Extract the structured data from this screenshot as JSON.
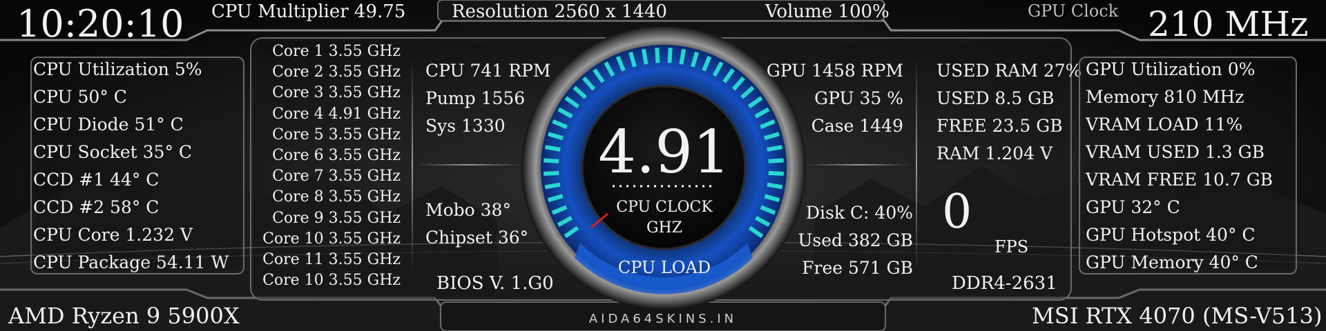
{
  "top": {
    "time": "10:20:10",
    "cpu_multiplier": "CPU Multiplier 49.75",
    "resolution": "Resolution 2560 x 1440",
    "volume": "Volume 100%",
    "gpu_clock_label": "GPU Clock",
    "gpu_clock_value": "210 MHz"
  },
  "cpu_panel": [
    "CPU Utilization 5%",
    "CPU 50° C",
    "CPU Diode 51° C",
    "CPU Socket 35° C",
    "CCD #1 44° C",
    "CCD #2 58° C",
    "CPU Core 1.232 V",
    "CPU Package 54.11 W"
  ],
  "cores": [
    "Core 1  3.55 GHz",
    "Core 2  3.55 GHz",
    "Core 3  3.55 GHz",
    "Core 4  4.91 GHz",
    "Core 5  3.55 GHz",
    "Core 6  3.55 GHz",
    "Core 7  3.55 GHz",
    "Core 8  3.55 GHz",
    "Core 9  3.55 GHz",
    "Core 10  3.55 GHz",
    "Core 11  3.55 GHz",
    "Core 10  3.55 GHz"
  ],
  "fans_left": [
    "CPU 741 RPM",
    "Pump 1556",
    "Sys 1330"
  ],
  "temps_left": [
    "Mobo 38°",
    "Chipset 36°"
  ],
  "bios": "BIOS V. 1.G0",
  "gauge": {
    "value": "4.91",
    "label_line1": "CPU CLOCK",
    "label_line2": "GHZ",
    "load_label": "CPU LOAD",
    "accent": "#29d6d0",
    "ring_blue": "#1a5fd6",
    "needle": "#e02020"
  },
  "fans_right": [
    "GPU 1458 RPM",
    "GPU 35  %",
    "Case 1449"
  ],
  "disk": [
    "Disk C: 40%",
    "Used 382 GB",
    "Free 571 GB"
  ],
  "ram": [
    "USED RAM 27%",
    "USED 8.5 GB",
    "FREE 23.5 GB",
    "RAM 1.204 V"
  ],
  "fps": {
    "value": "0",
    "label": "FPS"
  },
  "ddr": "DDR4-2631",
  "gpu_panel": [
    "GPU Utilization 0%",
    "Memory 810 MHz",
    "VRAM LOAD 11%",
    "VRAM USED 1.3 GB",
    "VRAM FREE 10.7 GB",
    "GPU 32° C",
    "GPU Hotspot 40° C",
    "GPU Memory 40° C"
  ],
  "bottom": {
    "cpu_name": "AMD Ryzen 9 5900X",
    "site": "AIDA64SKINS.IN",
    "gpu_name": "MSI RTX 4070 (MS-V513)"
  }
}
